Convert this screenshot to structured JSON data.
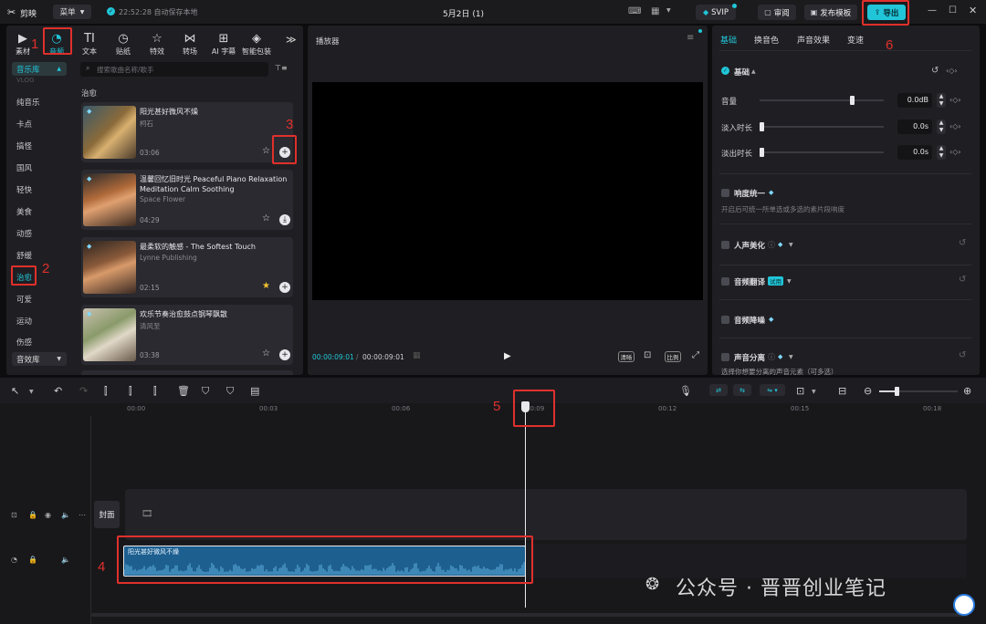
{
  "titlebar": {
    "app_name": "剪映",
    "menu_label": "菜单",
    "autosave": "22:52:28 自动保存本地",
    "project_title": "5月2日 (1)",
    "svip_label": "SVIP",
    "review_label": "审阅",
    "publish_label": "发布模板",
    "export_label": "导出"
  },
  "toolbar_tabs": [
    {
      "label": "素材",
      "icon": "media-icon"
    },
    {
      "label": "音频",
      "icon": "audio-icon"
    },
    {
      "label": "文本",
      "icon": "text-icon"
    },
    {
      "label": "贴纸",
      "icon": "sticker-icon"
    },
    {
      "label": "特效",
      "icon": "effects-icon"
    },
    {
      "label": "转场",
      "icon": "transition-icon"
    },
    {
      "label": "AI 字幕",
      "icon": "ai-caption-icon"
    },
    {
      "label": "智能包装",
      "icon": "smart-pack-icon"
    }
  ],
  "library": {
    "dropdown": "音乐库",
    "faded_item": "VLOG",
    "categories": [
      "纯音乐",
      "卡点",
      "搞怪",
      "国风",
      "轻快",
      "美食",
      "动感",
      "舒缓",
      "治愈",
      "可爱",
      "运动",
      "伤感"
    ],
    "selected": "治愈",
    "sfx_dropdown": "音效库"
  },
  "search": {
    "placeholder": "搜索歌曲名称/歌手"
  },
  "section_title": "治愈",
  "songs": [
    {
      "title": "阳光甚好微风不燥",
      "artist": "柯石",
      "duration": "03:06",
      "action": "+"
    },
    {
      "title": "温馨回忆旧时光  Peaceful Piano Relaxation Meditation Calm Soothing",
      "artist": "Space Flower",
      "duration": "04:29",
      "action": "⤓"
    },
    {
      "title": "最柔软的触感 - The Softest Touch",
      "artist": "Lynne Publishing",
      "duration": "02:15",
      "action": "+"
    },
    {
      "title": "欢乐节奏治愈鼓点钢琴飘散",
      "artist": "清风至",
      "duration": "03:38",
      "action": "+"
    }
  ],
  "player": {
    "title": "播放器",
    "current_time": "00:00:09:01",
    "total_time": "00:00:09:01",
    "quality_label": "清晰",
    "ratio_label": "比例"
  },
  "right_tabs": [
    "基础",
    "换音色",
    "声音效果",
    "变速"
  ],
  "basic": {
    "section": "基础",
    "volume_label": "音量",
    "volume_value": "0.0dB",
    "volume_level": 0.74,
    "fadein_label": "淡入时长",
    "fadein_value": "0.0s",
    "fadeout_label": "淡出时长",
    "fadeout_value": "0.0s"
  },
  "loudness": {
    "title": "响度统一",
    "desc": "开启后可统一所单选或多选的素片段响度"
  },
  "voice_beautify": "人声美化",
  "audio_translate": "音频翻译",
  "trial_badge": "试用",
  "denoise": "音频降噪",
  "voice_separation": {
    "title": "声音分离",
    "desc": "选择你想要分离的声音元素（可多选）"
  },
  "timeline": {
    "ticks": [
      "00:00",
      "00:03",
      "00:06",
      "00:09",
      "00:12",
      "00:15",
      "00:18"
    ],
    "cover_label": "封面",
    "audio_clip_label": "阳光甚好微风不燥"
  },
  "annotations": [
    "1",
    "2",
    "3",
    "4",
    "5",
    "6"
  ],
  "watermark": "公众号 · 晋晋创业笔记",
  "colors": {
    "accent": "#21c5d8",
    "highlight": "#e0302c",
    "clip": "#1d5f8f"
  }
}
